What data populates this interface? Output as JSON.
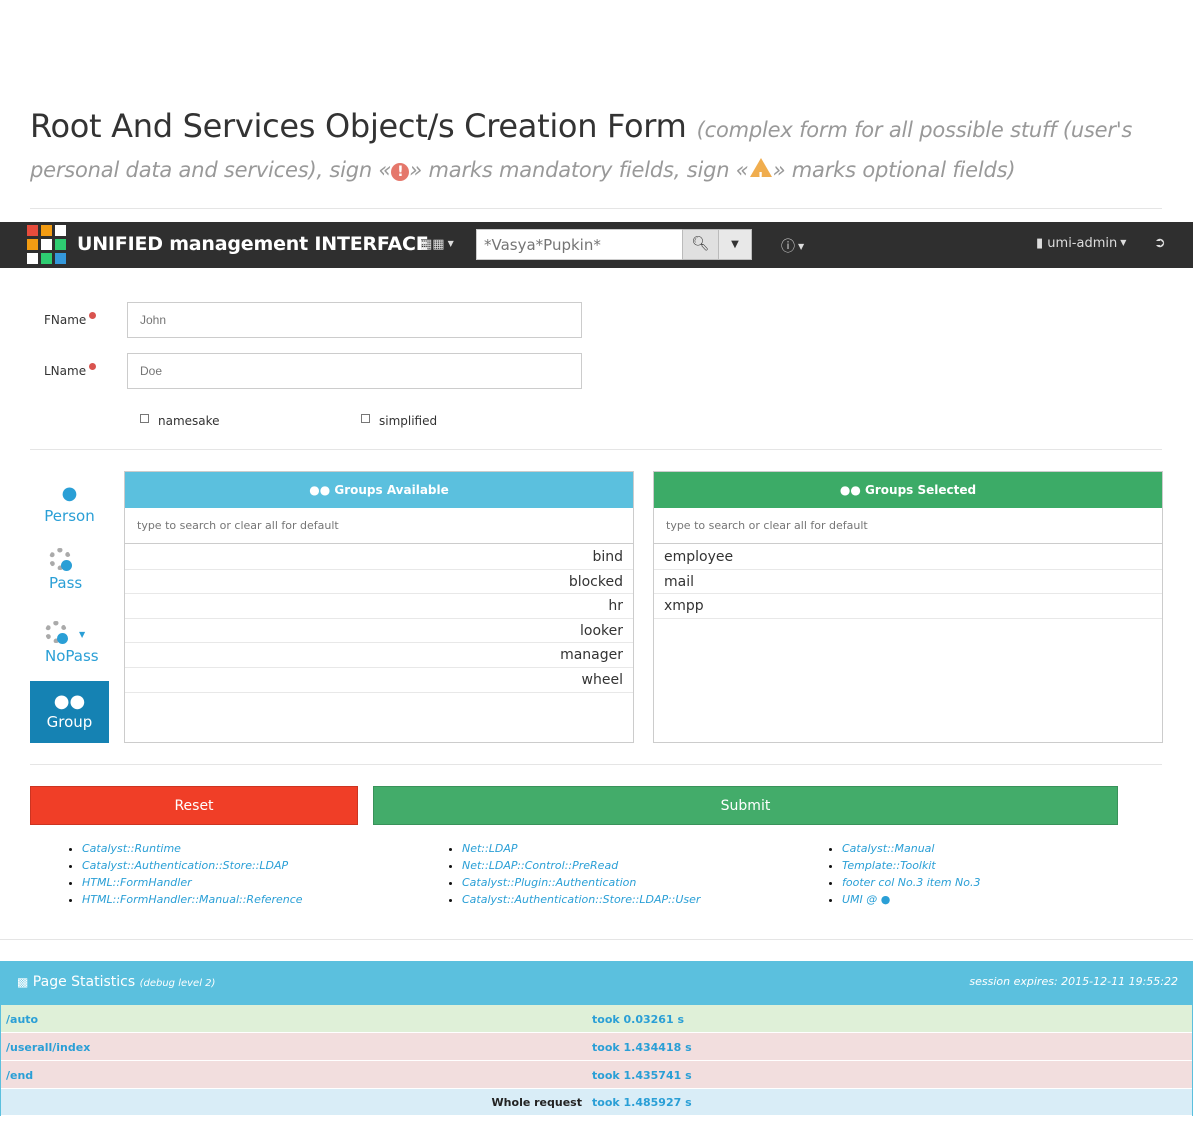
{
  "header": {
    "title": "Root And Services Object/s Creation Form",
    "subtitle_part1": "(complex form for all possible stuff (user's personal data and services), sign «",
    "subtitle_part2": "» marks mandatory fields, sign «",
    "subtitle_part3": "» marks optional fields)"
  },
  "navbar": {
    "brand": "UNIFIED management INTERFACE",
    "search_placeholder": "*Vasya*Pupkin*",
    "user": "umi-admin",
    "logo_colors": [
      "#e74c3c",
      "#f39c12",
      "#ffffff",
      "#f39c12",
      "#ffffff",
      "#2ecc71",
      "#ffffff",
      "#2ecc71",
      "#3498db"
    ]
  },
  "form": {
    "fname_label": "FName",
    "fname_placeholder": "John",
    "lname_label": "LName",
    "lname_placeholder": "Doe",
    "namesake_label": "namesake",
    "simplified_label": "simplified"
  },
  "sidenav": [
    {
      "label": "Person",
      "icon": "user-icon"
    },
    {
      "label": "Pass",
      "icon": "user-gear-icon"
    },
    {
      "label": "NoPass",
      "icon": "user-gear-x-icon"
    },
    {
      "label": "Group",
      "icon": "users-icon"
    }
  ],
  "groups_available": {
    "title": "Groups Available",
    "search_placeholder": "type to search or clear all for default",
    "items": [
      "bind",
      "blocked",
      "hr",
      "looker",
      "manager",
      "wheel"
    ],
    "color": "#5bc0de"
  },
  "groups_selected": {
    "title": "Groups Selected",
    "search_placeholder": "type to search or clear all for default",
    "items": [
      "employee",
      "mail",
      "xmpp"
    ],
    "color": "#3cab67"
  },
  "buttons": {
    "reset": "Reset",
    "submit": "Submit",
    "reset_color": "#f03e27",
    "submit_color": "#43ac6a"
  },
  "footer": {
    "col1": [
      "Catalyst::Runtime",
      "Catalyst::Authentication::Store::LDAP",
      "HTML::FormHandler",
      "HTML::FormHandler::Manual::Reference"
    ],
    "col2": [
      "Net::LDAP",
      "Net::LDAP::Control::PreRead",
      "Catalyst::Plugin::Authentication",
      "Catalyst::Authentication::Store::LDAP::User"
    ],
    "col3": [
      "Catalyst::Manual",
      "Template::Toolkit",
      "footer col No.3 item No.3",
      "UMI @"
    ]
  },
  "stats": {
    "title": "Page Statistics",
    "debug": "(debug level 2)",
    "session": "session expires: 2015-12-11 19:55:22",
    "rows": [
      {
        "path": "/auto",
        "took": "took 0.03261 s",
        "bg": "#dff0d8"
      },
      {
        "path": "/userall/index",
        "took": "took 1.434418 s",
        "bg": "#f2dede"
      },
      {
        "path": "/end",
        "took": "took 1.435741 s",
        "bg": "#f2dede"
      }
    ],
    "whole_label": "Whole request",
    "whole_took": "took 1.485927 s"
  }
}
